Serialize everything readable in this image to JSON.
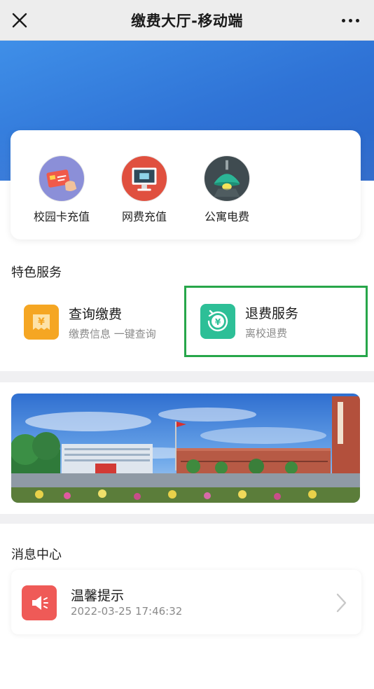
{
  "navbar": {
    "title": "缴费大厅-移动端"
  },
  "quick_services": [
    {
      "label": "校园卡充值",
      "icon": "campus-card-icon",
      "color": "#8b8fd8"
    },
    {
      "label": "网费充值",
      "icon": "monitor-icon",
      "color": "#e0503f"
    },
    {
      "label": "公寓电费",
      "icon": "lamp-icon",
      "color": "#3f4b50"
    }
  ],
  "featured": {
    "title": "特色服务",
    "items": [
      {
        "title": "查询缴费",
        "subtitle": "缴费信息 一键查询",
        "icon": "yuan-receipt-icon",
        "color": "#f5a623"
      },
      {
        "title": "退费服务",
        "subtitle": "离校退费",
        "icon": "yuan-refund-icon",
        "color": "#2dbf97",
        "highlighted": true
      }
    ]
  },
  "messages": {
    "title": "消息中心",
    "items": [
      {
        "title": "温馨提示",
        "time": "2022-03-25 17:46:32",
        "icon": "megaphone-icon",
        "color": "#ef5a57"
      }
    ]
  },
  "colors": {
    "banner_blue": "#2f73d6",
    "highlight_border": "#27a64a"
  }
}
